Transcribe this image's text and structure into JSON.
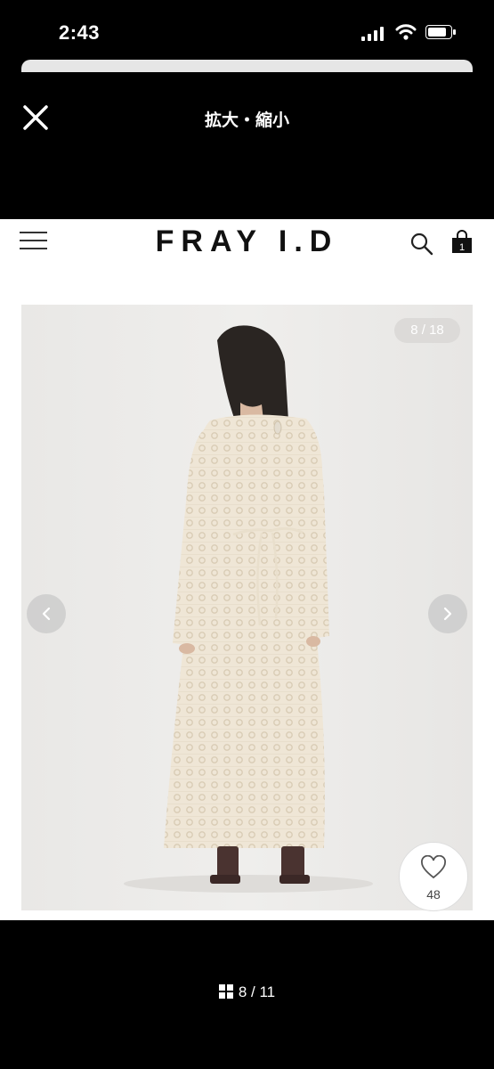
{
  "status_bar": {
    "time": "2:43"
  },
  "viewer": {
    "title": "拡大・縮小",
    "page_indicator": "8 / 11"
  },
  "site": {
    "brand": "FRAY I.D",
    "cart_count": "1"
  },
  "gallery": {
    "counter": "8 / 18",
    "favorite_count": "48"
  },
  "colors": {
    "background": "#000000",
    "page": "#ffffff",
    "photo_bg": "#ecebea",
    "dress": "#efe6d6"
  }
}
